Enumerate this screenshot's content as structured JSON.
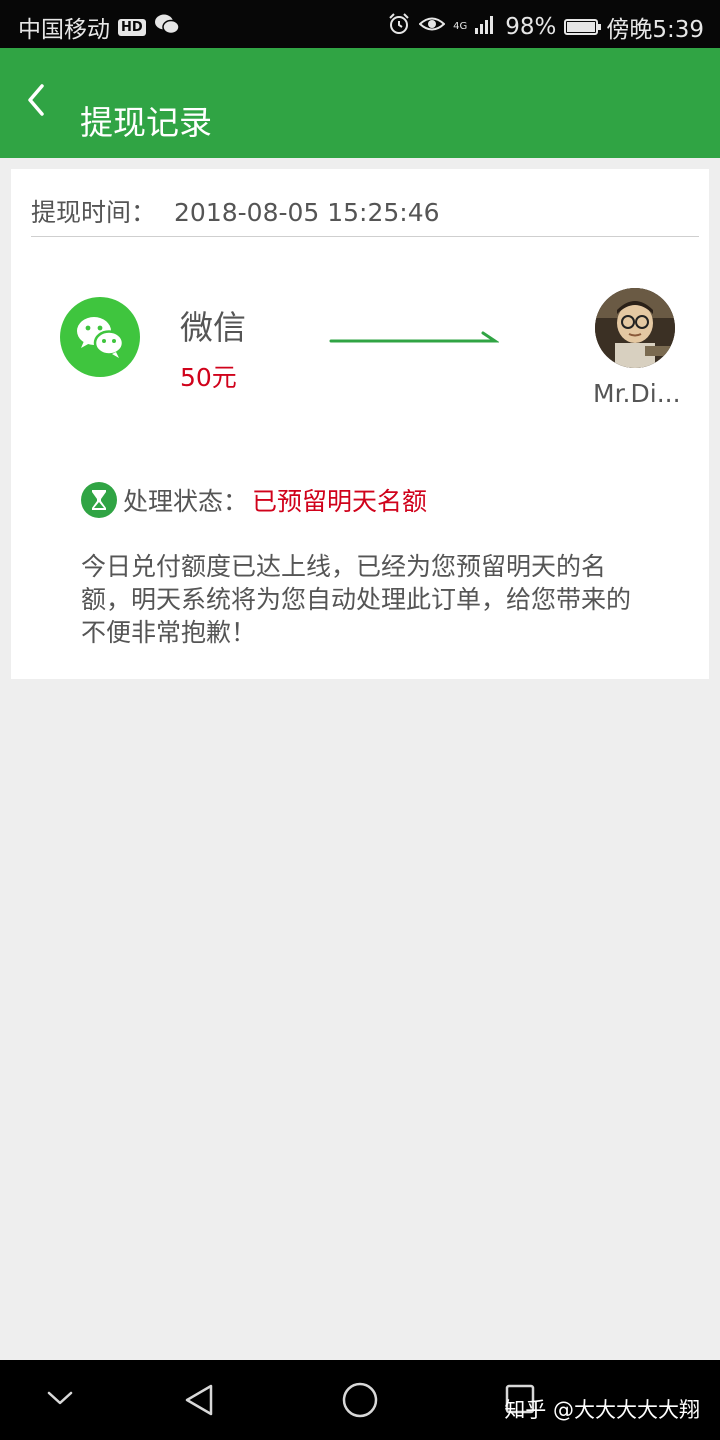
{
  "status_bar": {
    "carrier": "中国移动",
    "hd": "HD",
    "network": "4G",
    "battery": "98%",
    "battery_level": 0.98,
    "time": "傍晚5:39"
  },
  "header": {
    "title": "提现记录"
  },
  "record": {
    "time_label": "提现时间：",
    "time_value": "2018-08-05 15:25:46",
    "method": "微信",
    "amount": "50元",
    "recipient": "Mr.Di...",
    "status_label": "处理状态：",
    "status_value": "已预留明天名额",
    "notice": "今日兑付额度已达上线，已经为您预留明天的名额，明天系统将为您自动处理此订单，给您带来的不便非常抱歉！"
  },
  "watermark": "知乎 @大大大大大翔",
  "colors": {
    "brand_green": "#30a444",
    "wechat_green": "#3fc53e",
    "alert_red": "#d0021b"
  }
}
